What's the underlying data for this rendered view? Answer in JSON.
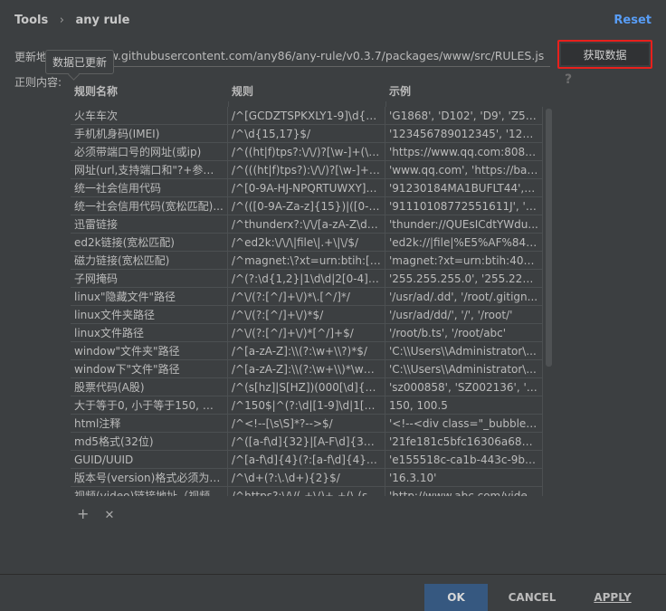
{
  "breadcrumb": [
    "Tools",
    "any rule"
  ],
  "breadcrumb_sep": "›",
  "reset_label": "Reset",
  "update_label": "更新地",
  "update_url": "raw.githubusercontent.com/any86/any-rule/v0.3.7/packages/www/src/RULES.js",
  "tooltip": "数据已更新",
  "fetch_label": "获取数据",
  "content_label": "正则内容:",
  "help": "?",
  "columns": [
    "规则名称",
    "规则",
    "示例"
  ],
  "rows": [
    [
      "火车车次",
      "/^[GCDZTSPKXLY1-9]\\d{1,...",
      "'G1868', 'D102', 'D9', 'Z5', '..."
    ],
    [
      "手机机身码(IMEI)",
      "/^\\d{15,17}$/",
      "'123456789012345', '1234..."
    ],
    [
      "必须带端口号的网址(或ip)",
      "/^((ht|f)tps?:\\/\\/)?[\\w-]+(\\.[...",
      "'https://www.qq.com:8080'..."
    ],
    [
      "网址(url,支持端口和\"?+参数\"...",
      "/^(((ht|f)tps?):\\/\\/)?[\\w-]+(\\...",
      "'www.qq.com', 'https://bai..."
    ],
    [
      "统一社会信用代码",
      "/^[0-9A-HJ-NPQRTUWXY]{...",
      "'91230184MA1BUFLT44', '..."
    ],
    [
      "统一社会信用代码(宽松匹配)...",
      "/^(([0-9A-Za-z]{15})|([0-9A...",
      "'91110108772551611J', '91..."
    ],
    [
      "迅雷链接",
      "/^thunderx?:\\/\\/[a-zA-Z\\d]...",
      "'thunder://QUEsICdtYWdu..."
    ],
    [
      "ed2k链接(宽松匹配)",
      "/^ed2k:\\/\\/\\|file\\|.+\\|\\/$/",
      "'ed2k://|file|%E5%AF%84%..."
    ],
    [
      "磁力链接(宽松匹配)",
      "/^magnet:\\?xt=urn:btih:[0-...",
      "'magnet:?xt=urn:btih:40A8..."
    ],
    [
      "子网掩码",
      "/^(?:\\d{1,2}|1\\d\\d|2[0-4]\\d|...",
      "'255.255.255.0', '255.224.0.0'"
    ],
    [
      "linux\"隐藏文件\"路径",
      "/^\\/(?:[^/]+\\/)*\\.[^/]*/",
      "'/usr/ad/.dd', '/root/.gitign..."
    ],
    [
      "linux文件夹路径",
      "/^\\/(?:[^/]+\\/)*$/",
      "'/usr/ad/dd/', '/', '/root/'"
    ],
    [
      "linux文件路径",
      "/^\\/(?:[^/]+\\/)*[^/]+$/",
      "'/root/b.ts', '/root/abc'"
    ],
    [
      "window\"文件夹\"路径",
      "/^[a-zA-Z]:\\\\(?:\\w+\\\\?)*$/",
      "'C:\\\\Users\\\\Administrator\\..."
    ],
    [
      "window下\"文件\"路径",
      "/^[a-zA-Z]:\\\\(?:\\w+\\\\)*\\w+...",
      "'C:\\\\Users\\\\Administrator\\..."
    ],
    [
      "股票代码(A股)",
      "/^(s[hz]|S[HZ])(000[\\d]{3}|0...",
      "'sz000858', 'SZ002136', 'sz..."
    ],
    [
      "大于等于0, 小于等于150, 支...",
      "/^150$|^(?:\\d|[1-9]\\d|1[0-...",
      "150, 100.5"
    ],
    [
      "html注释",
      "/^<!--[\\s\\S]*?-->$/",
      "'<!--<div class=\"_bubble\"..."
    ],
    [
      "md5格式(32位)",
      "/^([a-f\\d]{32}|[A-F\\d]{32})$/",
      "'21fe181c5bfc16306a6828..."
    ],
    [
      "GUID/UUID",
      "/^[a-f\\d]{4}(?:[a-f\\d]{4}-){4}...",
      "'e155518c-ca1b-443c-9be..."
    ],
    [
      "版本号(version)格式必须为X...",
      "/^\\d+(?:\\.\\d+){2}$/",
      "'16.3.10'"
    ],
    [
      "视频(video)链接地址（视频...",
      "/^https?:\\/\\/(.+\\/)+.+(\\.(sw...",
      "'http://www.abc.com/vide..."
    ]
  ],
  "add_icon": "+",
  "remove_icon": "✕",
  "buttons": {
    "ok": "OK",
    "cancel": "CANCEL",
    "apply": "APPLY"
  }
}
